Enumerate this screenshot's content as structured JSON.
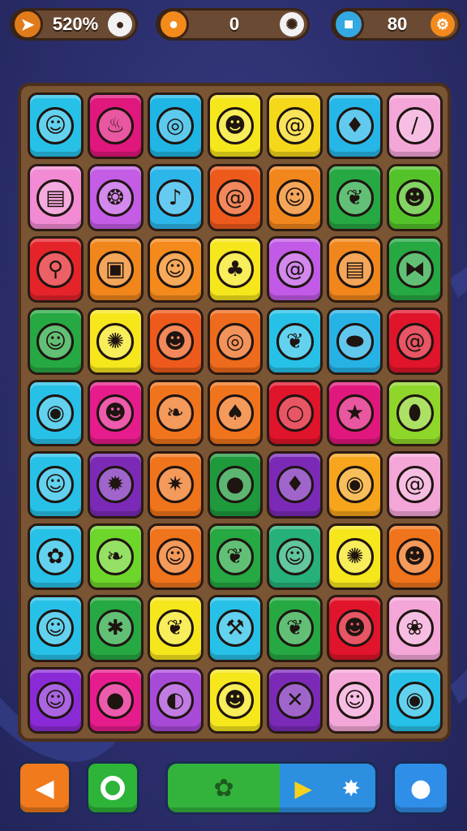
{
  "hud": {
    "progress": {
      "value": "520%",
      "badge_icon": "diamond-arrow-icon",
      "end_icon": "ghost-icon"
    },
    "coins": {
      "value": "0",
      "badge_icon": "coin-icon",
      "end_icon": "swirl-icon"
    },
    "moves": {
      "value": "80",
      "badge_icon": "robot-icon",
      "end_icon": "gear-icon"
    }
  },
  "board": {
    "rows": 9,
    "columns": 7,
    "tiles": [
      [
        {
          "color": "#27c1e8",
          "icon": "sun-face-icon"
        },
        {
          "color": "#e0177c",
          "icon": "flame-icon"
        },
        {
          "color": "#1fb6e6",
          "icon": "target-swirl-icon"
        },
        {
          "color": "#f6e61c",
          "icon": "green-blob-icon"
        },
        {
          "color": "#f6d81a",
          "icon": "spiral-shell-icon"
        },
        {
          "color": "#26b6e8",
          "icon": "red-flame-icon"
        },
        {
          "color": "#f4a6d8",
          "icon": "feather-icon"
        }
      ],
      [
        {
          "color": "#f28bd3",
          "icon": "cake-icon"
        },
        {
          "color": "#c45ce6",
          "icon": "onion-icon"
        },
        {
          "color": "#2db6ea",
          "icon": "bell-icon"
        },
        {
          "color": "#ee5a1c",
          "icon": "lollipop-icon"
        },
        {
          "color": "#f0861c",
          "icon": "water-drop-face-icon"
        },
        {
          "color": "#26a842",
          "icon": "leaf-icon"
        },
        {
          "color": "#54c32a",
          "icon": "pumpkin-face-icon"
        }
      ],
      [
        {
          "color": "#e5242a",
          "icon": "scooter-icon"
        },
        {
          "color": "#f0861c",
          "icon": "gift-box-icon"
        },
        {
          "color": "#f48a1c",
          "icon": "duck-icon"
        },
        {
          "color": "#f6e61c",
          "icon": "pink-cat-icon"
        },
        {
          "color": "#c15ae6",
          "icon": "purple-swirl-icon"
        },
        {
          "color": "#f0861c",
          "icon": "cake-box-icon"
        },
        {
          "color": "#26a842",
          "icon": "fish-icon"
        }
      ],
      [
        {
          "color": "#26a842",
          "icon": "cat-face-icon"
        },
        {
          "color": "#f6e61c",
          "icon": "pink-sun-icon"
        },
        {
          "color": "#ee5a1c",
          "icon": "sleepy-blob-icon"
        },
        {
          "color": "#ee6a1c",
          "icon": "white-swirl-icon"
        },
        {
          "color": "#27c1e8",
          "icon": "leaf-icon"
        },
        {
          "color": "#27b2e6",
          "icon": "lemon-icon"
        },
        {
          "color": "#e0142a",
          "icon": "orange-swirl-icon"
        }
      ],
      [
        {
          "color": "#27c1e8",
          "icon": "eye-ring-icon"
        },
        {
          "color": "#e61c8c",
          "icon": "chick-icon"
        },
        {
          "color": "#f0741c",
          "icon": "carrot-icon"
        },
        {
          "color": "#f0741c",
          "icon": "garlic-icon"
        },
        {
          "color": "#e0142a",
          "icon": "blue-ring-icon"
        },
        {
          "color": "#e0177c",
          "icon": "star-icon"
        },
        {
          "color": "#8ed62a",
          "icon": "eggplant-icon"
        }
      ],
      [
        {
          "color": "#27c1e8",
          "icon": "berry-face-icon"
        },
        {
          "color": "#7b2ab8",
          "icon": "orange-flame-icon"
        },
        {
          "color": "#f0741c",
          "icon": "virus-face-icon"
        },
        {
          "color": "#1e9a3c",
          "icon": "apple-icon"
        },
        {
          "color": "#7b2ab8",
          "icon": "fire-drop-icon"
        },
        {
          "color": "#f6a51c",
          "icon": "blue-chat-icon"
        },
        {
          "color": "#f4a6d8",
          "icon": "red-swirl-icon"
        }
      ],
      [
        {
          "color": "#27c1e8",
          "icon": "raspberry-icon"
        },
        {
          "color": "#6dd62a",
          "icon": "carrot-icon"
        },
        {
          "color": "#f0741c",
          "icon": "blue-blob-icon"
        },
        {
          "color": "#26a842",
          "icon": "purple-leaf-icon"
        },
        {
          "color": "#26b07a",
          "icon": "orange-seed-icon"
        },
        {
          "color": "#f6e61c",
          "icon": "smiling-sun-icon"
        },
        {
          "color": "#f0741c",
          "icon": "robot-face-icon"
        }
      ],
      [
        {
          "color": "#27c1e8",
          "icon": "smile-drop-icon"
        },
        {
          "color": "#26a842",
          "icon": "purple-bug-icon"
        },
        {
          "color": "#f6e61c",
          "icon": "leaf-icon"
        },
        {
          "color": "#27c1e8",
          "icon": "hammer-icon"
        },
        {
          "color": "#26a842",
          "icon": "leaf-icon"
        },
        {
          "color": "#e0142a",
          "icon": "red-cat-icon"
        },
        {
          "color": "#f4a6d8",
          "icon": "monster-blob-icon"
        }
      ],
      [
        {
          "color": "#8a2ad6",
          "icon": "smiley-icon"
        },
        {
          "color": "#e61c8c",
          "icon": "watermelon-icon"
        },
        {
          "color": "#a84ad8",
          "icon": "seed-icon"
        },
        {
          "color": "#f6e61c",
          "icon": "red-blob-icon"
        },
        {
          "color": "#7b2ab8",
          "icon": "crossed-swords-icon"
        },
        {
          "color": "#f4a6d8",
          "icon": "ghost-face-icon"
        },
        {
          "color": "#27c1e8",
          "icon": "green-ring-icon"
        }
      ]
    ]
  },
  "bottom_bar": {
    "back": {
      "icon": "back-arrow-icon"
    },
    "hint": {
      "icon": "ring-icon"
    },
    "progress": {
      "fill_fraction": 0.54,
      "fill_icon": "leaf-icon",
      "play_icon": "play-icon",
      "fx_icon": "splash-icon"
    },
    "help": {
      "icon": "ghost-icon"
    }
  }
}
